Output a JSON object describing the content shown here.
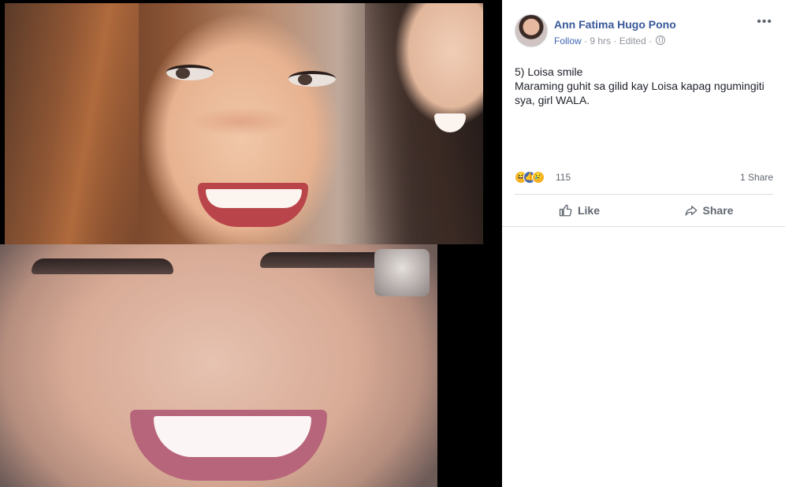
{
  "post": {
    "author": "Ann Fatima Hugo Pono",
    "follow_label": "Follow",
    "sep1": " · ",
    "time": "9 hrs",
    "sep2": " · ",
    "edited": "Edited",
    "sep3": " · ",
    "more_label": "•••",
    "text_line1": "5) Loisa smile",
    "text_line2": "Maraming guhit sa gilid kay Loisa kapag ngumingiti sya, girl WALA.",
    "reaction_count": "115",
    "share_count": "1 Share",
    "like_label": "Like",
    "share_label": "Share"
  },
  "icons": {
    "privacy": "globe-icon",
    "reactions": [
      "haha-icon",
      "like-icon",
      "sad-icon"
    ],
    "like": "thumbs-up-icon",
    "share": "share-arrow-icon"
  },
  "colors": {
    "author": "#385898",
    "link": "#4267b2",
    "meta": "#90949c",
    "text": "#1d2129",
    "action": "#606770",
    "divider": "#dadde1"
  }
}
